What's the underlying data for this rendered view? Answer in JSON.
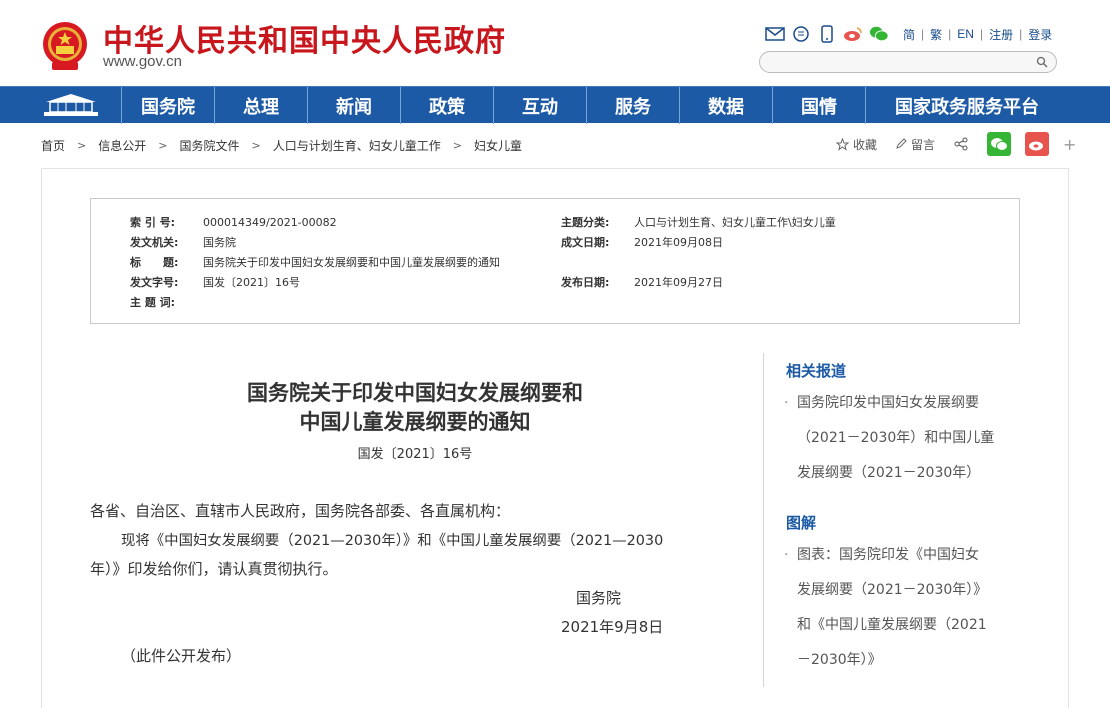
{
  "header": {
    "site_title": "中华人民共和国中央人民政府",
    "site_url": "www.gov.cn",
    "lang_links": [
      "简",
      "繁",
      "EN",
      "注册",
      "登录"
    ],
    "tool_icons": [
      "mail-icon",
      "message-icon",
      "mobile-icon",
      "weibo-icon",
      "wechat-icon"
    ]
  },
  "nav": {
    "items": [
      "国务院",
      "总理",
      "新闻",
      "政策",
      "互动",
      "服务",
      "数据",
      "国情",
      "国家政务服务平台"
    ]
  },
  "breadcrumb": [
    "首页",
    "信息公开",
    "国务院文件",
    "人口与计划生育、妇女儿童工作",
    "妇女儿童"
  ],
  "share": {
    "favorite": "收藏",
    "comment": "留言",
    "plus": "+"
  },
  "meta": {
    "index_label": "索 引 号:",
    "index_value": "000014349/2021-00082",
    "topic_label": "主题分类:",
    "topic_value": "人口与计划生育、妇女儿童工作\\妇女儿童",
    "issuer_label": "发文机关:",
    "issuer_value": "国务院",
    "created_label": "成文日期:",
    "created_value": "2021年09月08日",
    "title_label": "标　　题:",
    "title_value": "国务院关于印发中国妇女发展纲要和中国儿童发展纲要的通知",
    "docno_label": "发文字号:",
    "docno_value": "国发〔2021〕16号",
    "published_label": "发布日期:",
    "published_value": "2021年09月27日",
    "keywords_label": "主 题 词:",
    "keywords_value": ""
  },
  "article": {
    "title_line1": "国务院关于印发中国妇女发展纲要和",
    "title_line2": "中国儿童发展纲要的通知",
    "doc_number": "国发〔2021〕16号",
    "salutation": "各省、自治区、直辖市人民政府，国务院各部委、各直属机构：",
    "para1_line1": "现将《中国妇女发展纲要（2021—2030年）》和《中国儿童发展纲要（2021—2030",
    "para1_line2": "年）》印发给你们，请认真贯彻执行。",
    "signature": "国务院",
    "date": "2021年9月8日",
    "note": "（此件公开发布）"
  },
  "sidebar": {
    "related_heading": "相关报道",
    "related_link_lines": [
      "国务院印发中国妇女发展纲要",
      "（2021－2030年）和中国儿童",
      "发展纲要（2021－2030年）"
    ],
    "graphic_heading": "图解",
    "graphic_link_lines": [
      "图表：国务院印发《中国妇女",
      "发展纲要（2021－2030年）》",
      "和《中国儿童发展纲要（2021",
      "－2030年）》"
    ]
  },
  "colors": {
    "brand_red": "#c8161d",
    "nav_blue": "#1d5aa6",
    "wechat_green": "#35b534",
    "weibo_red": "#e6544d"
  }
}
